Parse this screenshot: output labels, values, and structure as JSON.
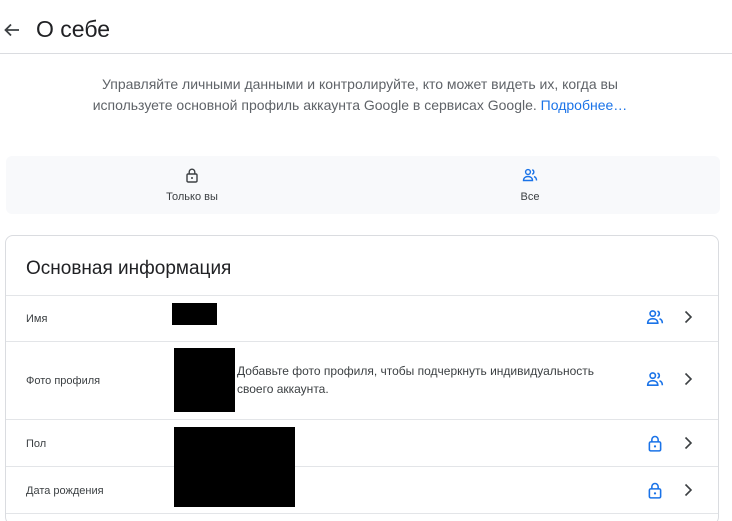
{
  "header": {
    "back_icon": "arrow-back-icon",
    "title": "О себе"
  },
  "intro": {
    "text": "Управляйте личными данными и контролируйте, кто может видеть их, когда вы используете основной профиль аккаунта Google в сервисах Google.",
    "link": "Подроб­нее…"
  },
  "legend": {
    "only_you": {
      "label": "Только вы",
      "icon": "lock-icon"
    },
    "everyone": {
      "label": "Все",
      "icon": "people-icon"
    }
  },
  "basic_info": {
    "title": "Основная информация",
    "rows": [
      {
        "label": "Имя",
        "value": "",
        "visibility_icon": "people-icon"
      },
      {
        "label": "Фото профиля",
        "value": "Добавьте фото профиля, чтобы подчеркнуть индивидуальность своего аккаунта.",
        "visibility_icon": "people-icon"
      },
      {
        "label": "Пол",
        "value": "",
        "visibility_icon": "lock-icon"
      },
      {
        "label": "Дата рождения",
        "value": "",
        "visibility_icon": "lock-icon"
      }
    ]
  },
  "colors": {
    "accent": "#1a73e8",
    "icon": "#5f6368",
    "text": "#202124"
  }
}
